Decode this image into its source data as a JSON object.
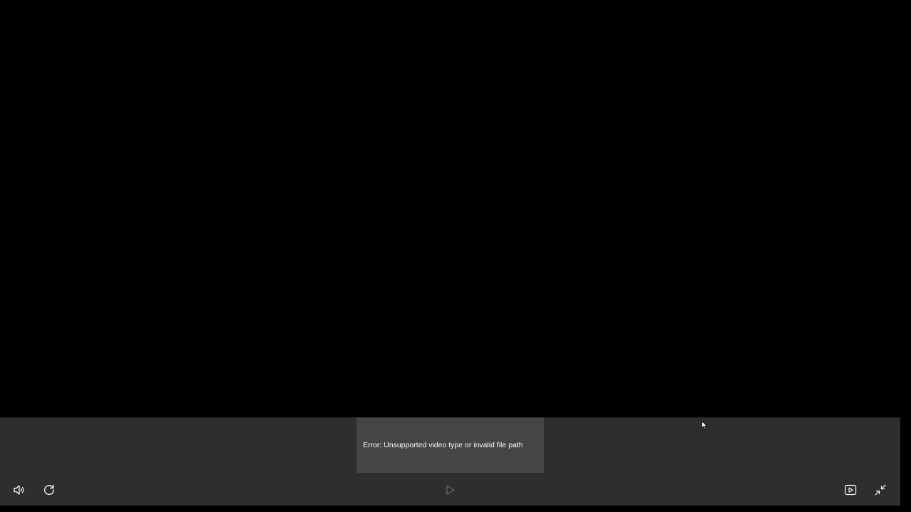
{
  "player": {
    "error_message": "Error: Unsupported video type or invalid file path"
  },
  "controls": {
    "left": [
      {
        "icon": "volume-icon"
      },
      {
        "icon": "replay-icon"
      }
    ],
    "center": [
      {
        "icon": "play-icon",
        "state": "disabled"
      }
    ],
    "right": [
      {
        "icon": "mini-player-icon"
      },
      {
        "icon": "exit-fullscreen-icon"
      }
    ]
  },
  "colors": {
    "video_background": "#000000",
    "control_bar": "#2e2e2e",
    "tooltip_background": "#454545",
    "icon": "#ffffff",
    "icon_disabled": "#6a6a6a"
  }
}
